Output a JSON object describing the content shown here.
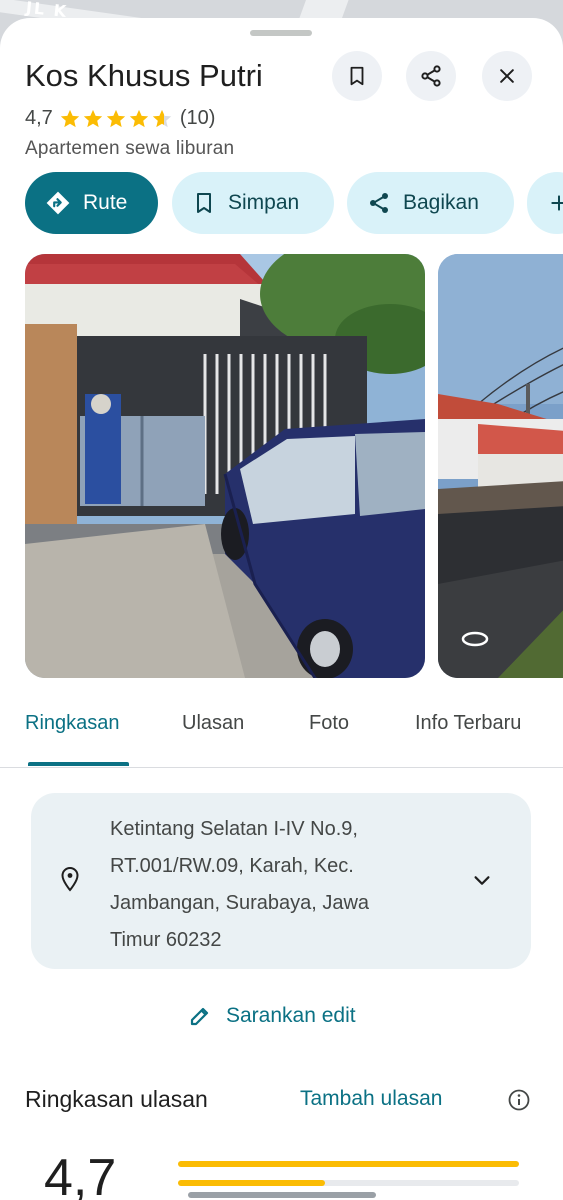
{
  "place": {
    "name": "Kos Khusus Putri",
    "rating": "4,7",
    "review_count": "(10)",
    "category": "Apartemen sewa liburan"
  },
  "actions": {
    "route_label": "Rute",
    "save_label": "Simpan",
    "share_label": "Bagikan"
  },
  "tabs": [
    {
      "label": "Ringkasan",
      "active": true
    },
    {
      "label": "Ulasan",
      "active": false
    },
    {
      "label": "Foto",
      "active": false
    },
    {
      "label": "Info Terbaru",
      "active": false
    }
  ],
  "address": {
    "line1": "Ketintang Selatan I-IV No.9,",
    "line2": "RT.001/RW.09, Karah, Kec.",
    "line3": "Jambangan, Surabaya, Jawa",
    "line4": "Timur 60232"
  },
  "suggest_edit_label": "Sarankan edit",
  "reviews": {
    "title": "Ringkasan ulasan",
    "add_label": "Tambah ulasan",
    "average": "4,7"
  },
  "colors": {
    "accent": "#0b7184",
    "chip_bg": "#d9f2f9",
    "star": "#fbbc04"
  }
}
